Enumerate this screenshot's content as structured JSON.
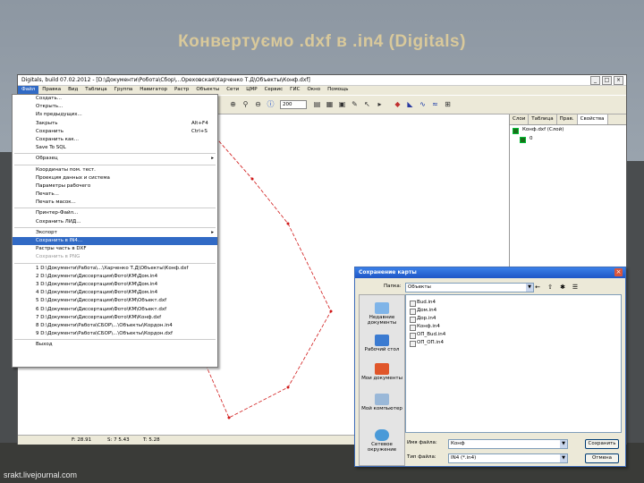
{
  "slide": {
    "title": "Конвертуємо .dxf в .in4 (Digitals)",
    "watermark": "srakt.livejournal.com"
  },
  "app": {
    "title": "Digitals, build 07.02.2012 - [D:\\Документи\\Робота\\Сбор\\...Ореховская\\Харченко Т.Д\\Объекты\\Конф.dxf]",
    "menubar": [
      "Файл",
      "Правка",
      "Вид",
      "Таблица",
      "Группа",
      "Навигатор",
      "Растр",
      "Объекты",
      "Сети",
      "ЦМР",
      "Сервис",
      "ГИС",
      "Окно",
      "Помощь"
    ],
    "zoom": "200",
    "panel": {
      "tabs": [
        "Слои",
        "Таблица",
        "Прав.",
        "Свойства"
      ],
      "tree": [
        "Конф.dxf (Слой)",
        "0"
      ]
    },
    "status": [
      "F: 28.91",
      "S: 7 5.43",
      "T: 5.28"
    ]
  },
  "file_menu": {
    "items": [
      {
        "label": "Создать...",
        "shortcut": "",
        "arrow": false,
        "hl": false,
        "dis": false
      },
      {
        "label": "Открыть...",
        "shortcut": "",
        "arrow": false,
        "hl": false,
        "dis": false
      },
      {
        "label": "Из предыдущих...",
        "shortcut": "",
        "arrow": false,
        "hl": false,
        "dis": false
      },
      {
        "label": "Закрыть",
        "shortcut": "Alt+F4",
        "arrow": false,
        "hl": false,
        "dis": false
      },
      {
        "label": "Сохранить",
        "shortcut": "Ctrl+S",
        "arrow": false,
        "hl": false,
        "dis": false
      },
      {
        "label": "Сохранить как...",
        "shortcut": "",
        "arrow": false,
        "hl": false,
        "dis": false
      },
      {
        "label": "Save To SQL",
        "shortcut": "",
        "arrow": false,
        "hl": false,
        "dis": false
      },
      {
        "sep": true
      },
      {
        "label": "Образец",
        "shortcut": "",
        "arrow": true,
        "hl": false,
        "dis": false
      },
      {
        "sep": true
      },
      {
        "label": "Координаты пом. тест.",
        "shortcut": "",
        "arrow": false,
        "hl": false,
        "dis": false
      },
      {
        "label": "Проекция данных и система",
        "shortcut": "",
        "arrow": false,
        "hl": false,
        "dis": false
      },
      {
        "label": "Параметры рабочего",
        "shortcut": "",
        "arrow": false,
        "hl": false,
        "dis": false
      },
      {
        "label": "Печать...",
        "shortcut": "",
        "arrow": false,
        "hl": false,
        "dis": false
      },
      {
        "label": "Печать масок...",
        "shortcut": "",
        "arrow": false,
        "hl": false,
        "dis": false
      },
      {
        "sep": true
      },
      {
        "label": "Принтер-Файл...",
        "shortcut": "",
        "arrow": false,
        "hl": false,
        "dis": false
      },
      {
        "label": "Сохранить ЛИД...",
        "shortcut": "",
        "arrow": false,
        "hl": false,
        "dis": false
      },
      {
        "sep": true
      },
      {
        "label": "Экспорт",
        "shortcut": "",
        "arrow": true,
        "hl": false,
        "dis": false
      },
      {
        "label": "Сохранить в IN4...",
        "shortcut": "",
        "arrow": false,
        "hl": true,
        "dis": false
      },
      {
        "label": "Растры часть в DXF",
        "shortcut": "",
        "arrow": false,
        "hl": false,
        "dis": false
      },
      {
        "label": "Сохранить в PNG",
        "shortcut": "",
        "arrow": false,
        "hl": false,
        "dis": true
      },
      {
        "sep": true
      },
      {
        "label": "1 D:\\Документи\\Работа\\...\\Харченко Т.Д\\Объекты\\Конф.dxf",
        "shortcut": "",
        "arrow": false,
        "hl": false,
        "dis": false
      },
      {
        "label": "2 D:\\Документи\\Диссертация\\Фото\\КМ\\Дом.in4",
        "shortcut": "",
        "arrow": false,
        "hl": false,
        "dis": false
      },
      {
        "label": "3 D:\\Документи\\Диссертация\\Фото\\КМ\\Дом.in4",
        "shortcut": "",
        "arrow": false,
        "hl": false,
        "dis": false
      },
      {
        "label": "4 D:\\Документи\\Диссертация\\Фото\\КМ\\Дом.in4",
        "shortcut": "",
        "arrow": false,
        "hl": false,
        "dis": false
      },
      {
        "label": "5 D:\\Документи\\Диссертация\\Фото\\КМ\\Объект.dxf",
        "shortcut": "",
        "arrow": false,
        "hl": false,
        "dis": false
      },
      {
        "label": "6 D:\\Документи\\Диссертация\\Фото\\КМ\\Объект.dxf",
        "shortcut": "",
        "arrow": false,
        "hl": false,
        "dis": false
      },
      {
        "label": "7 D:\\Документи\\Диссертация\\Фото\\КМ\\Конф.dxf",
        "shortcut": "",
        "arrow": false,
        "hl": false,
        "dis": false
      },
      {
        "label": "8 D:\\Документи\\Работа\\СБОР\\...\\Объекты\\Кордон.in4",
        "shortcut": "",
        "arrow": false,
        "hl": false,
        "dis": false
      },
      {
        "label": "9 D:\\Документи\\Работа\\СБОР\\...\\Объекты\\Кордон.dxf",
        "shortcut": "",
        "arrow": false,
        "hl": false,
        "dis": false
      },
      {
        "sep": true
      },
      {
        "label": "Выход",
        "shortcut": "",
        "arrow": false,
        "hl": false,
        "dis": false
      }
    ]
  },
  "save_dialog": {
    "title": "Сохранение карты",
    "folder_label": "Папка:",
    "folder_value": "Объекты",
    "places": [
      "Недавние документы",
      "Рабочий стол",
      "Мои документы",
      "Мой компьютер",
      "Сетевое окружение"
    ],
    "files": [
      "Bud.in4",
      "Дом.in4",
      "Дор.in4",
      "Конф.in4",
      "ОП_Bud.in4",
      "ОП_ОП.in4"
    ],
    "filename_label": "Имя файла:",
    "filename_value": "Конф",
    "filetype_label": "Тип файла:",
    "filetype_value": "IN4 (*.in4)",
    "save_button": "Сохранить",
    "cancel_button": "Отмена"
  },
  "colors": {
    "title_text": "#d9c99b",
    "menu_highlight": "#316ac5",
    "polyline": "#d01818"
  }
}
